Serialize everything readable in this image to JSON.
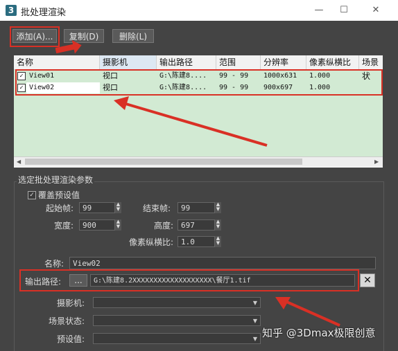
{
  "window": {
    "title": "批处理渲染",
    "app_icon": "3",
    "minimize": "—",
    "maximize": "☐",
    "close": "✕"
  },
  "toolbar": {
    "add_label": "添加(A)...",
    "copy_label": "复制(D)",
    "delete_label": "删除(L)"
  },
  "list": {
    "columns": [
      "名称",
      "摄影机",
      "输出路径",
      "范围",
      "分辨率",
      "像素纵横比",
      "场景状"
    ],
    "rows": [
      {
        "checked": true,
        "name": "View01",
        "camera": "视口",
        "path": "G:\\陈建8....",
        "range": "99 - 99",
        "resolution": "1000x631",
        "aspect": "1.000"
      },
      {
        "checked": true,
        "name": "View02",
        "camera": "视口",
        "path": "G:\\陈建8....",
        "range": "99 - 99",
        "resolution": "900x697",
        "aspect": "1.000"
      }
    ]
  },
  "params": {
    "section_title": "选定批处理渲染参数",
    "override_label": "覆盖预设值",
    "start_frame_label": "起始帧:",
    "start_frame_value": "99",
    "end_frame_label": "结束帧:",
    "end_frame_value": "99",
    "width_label": "宽度:",
    "width_value": "900",
    "height_label": "高度:",
    "height_value": "697",
    "aspect_label": "像素纵横比:",
    "aspect_value": "1.0",
    "name_label": "名称:",
    "name_value": "View02",
    "output_label": "输出路径:",
    "browse_label": "...",
    "output_value": "G:\\陈建8.2XXXXXXXXXXXXXXXXXXX\\餐厅1.tif",
    "clear_label": "✕",
    "camera_label": "摄影机:",
    "scene_state_label": "场景状态:",
    "preset_label": "预设值:"
  },
  "watermark": "知乎 @3Dmax极限创意",
  "colors": {
    "highlight_red": "#d93025",
    "list_row_green": "#d2ead3"
  }
}
